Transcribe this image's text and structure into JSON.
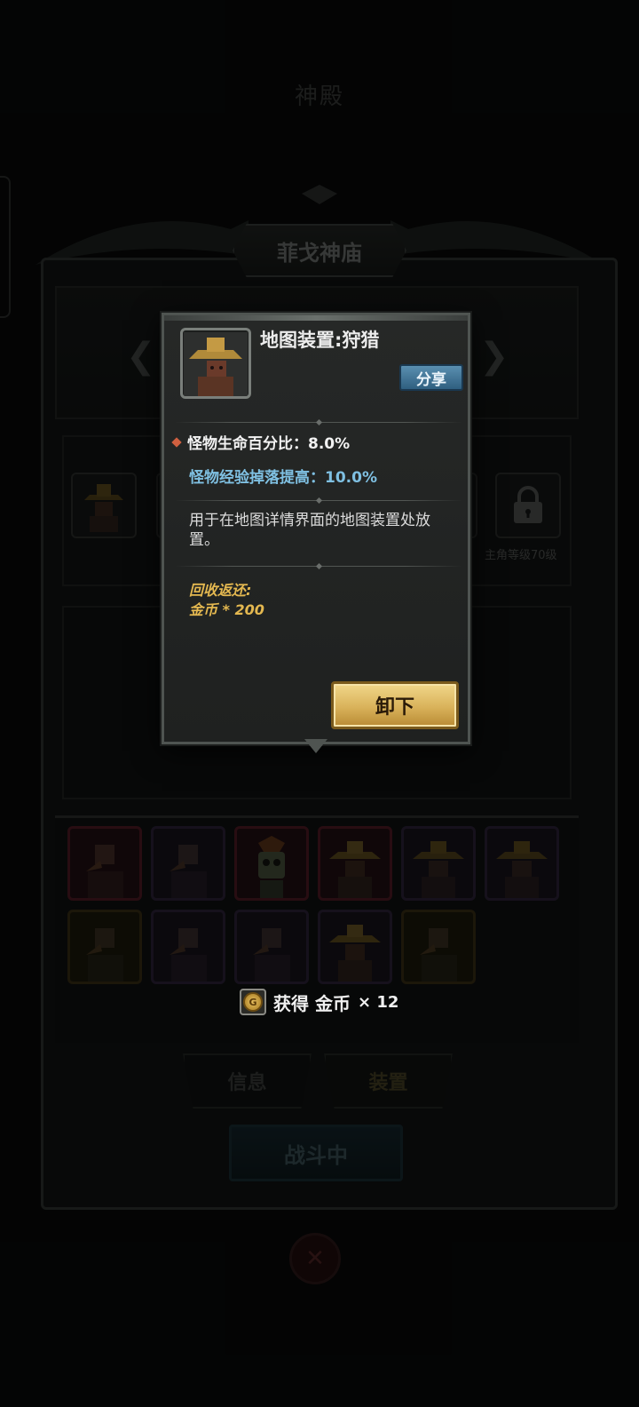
{
  "screen": {
    "top_title": "神殿",
    "header_title": "菲戈神庙",
    "lock_slot_label": "主角等级70级",
    "tabs": [
      {
        "label": "信息"
      },
      {
        "label": "装置"
      }
    ],
    "battle_button": "战斗中",
    "reward_toast": {
      "text": "获得 金币",
      "multiplier": "× 12",
      "coin_glyph": "G"
    }
  },
  "modal": {
    "title": "地图装置:狩猎",
    "share_button": "分享",
    "stat_primary": "怪物生命百分比：8.0%",
    "stat_secondary": "怪物经验掉落提高：10.0%",
    "description": "用于在地图详情界面的地图装置处放置。",
    "recycle_label": "回收返还:",
    "recycle_value": "金币 * 200",
    "unequip_button": "卸下"
  },
  "colors": {
    "stat_secondary": "#7fc0e2",
    "recycle_text": "#e4b850",
    "share_button": "#3f7497",
    "unequip_button": "#d9b25a"
  }
}
